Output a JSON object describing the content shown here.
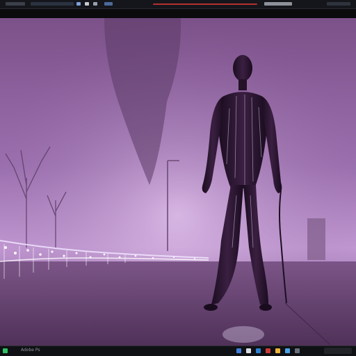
{
  "window": {
    "title": "",
    "taskbar_label": "Adobe Ps"
  },
  "scene": {
    "subject": "neon-lit-mannequin-figure",
    "background_color": "#8a5f9c",
    "fog_color": "#c49bd5",
    "figure_color": "#2a1530",
    "light_color": "#e9d8ff",
    "ground_color": "#5d3a66"
  },
  "icons": [
    "start-icon",
    "edge-icon",
    "explorer-icon",
    "store-icon",
    "chrome-icon",
    "files-icon",
    "mail-icon",
    "settings-icon"
  ]
}
